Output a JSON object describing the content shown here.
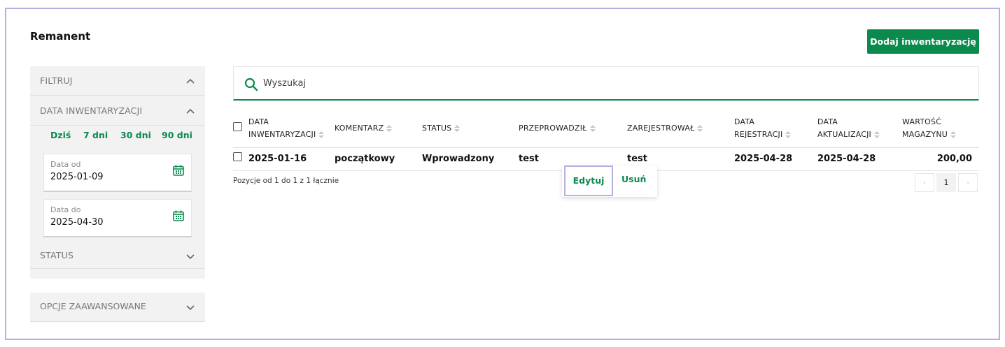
{
  "page": {
    "title": "Remanent",
    "add_button": "Dodaj inwentaryzację"
  },
  "sidebar": {
    "filter_label": "FILTRUJ",
    "date_section_label": "DATA INWENTARYZACJI",
    "quick_ranges": [
      "Dziś",
      "7 dni",
      "30 dni",
      "90 dni"
    ],
    "date_from": {
      "label": "Data od",
      "value": "2025-01-09"
    },
    "date_to": {
      "label": "Data do",
      "value": "2025-04-30"
    },
    "status_label": "STATUS",
    "advanced_label": "OPCJE ZAAWANSOWANE"
  },
  "search": {
    "placeholder": "Wyszukaj"
  },
  "table": {
    "headers": {
      "date_line1": "DATA",
      "date_line2": "INWENTARYZACJI",
      "comment": "KOMENTARZ",
      "status": "STATUS",
      "performed_by": "PRZEPROWADZIŁ",
      "registered_by": "ZAREJESTROWAŁ",
      "reg_date_line1": "DATA",
      "reg_date_line2": "REJESTRACJI",
      "upd_date_line1": "DATA",
      "upd_date_line2": "AKTUALIZACJI",
      "value_line1": "WARTOŚĆ",
      "value_line2": "MAGAZYNU"
    },
    "rows": [
      {
        "date": "2025-01-16",
        "comment": "początkowy",
        "status": "Wprowadzony",
        "performed_by": "test",
        "registered_by": "test",
        "reg_date": "2025-04-28",
        "upd_date": "2025-04-28",
        "value": "200,00"
      }
    ],
    "summary": "Pozycje od 1 do 1 z 1 łącznie"
  },
  "row_actions": {
    "edit": "Edytuj",
    "delete": "Usuń"
  },
  "pagination": {
    "prev": "‹",
    "current": "1",
    "next": "›"
  },
  "colors": {
    "accent": "#0b8a4e",
    "focus": "#b9aee0"
  }
}
